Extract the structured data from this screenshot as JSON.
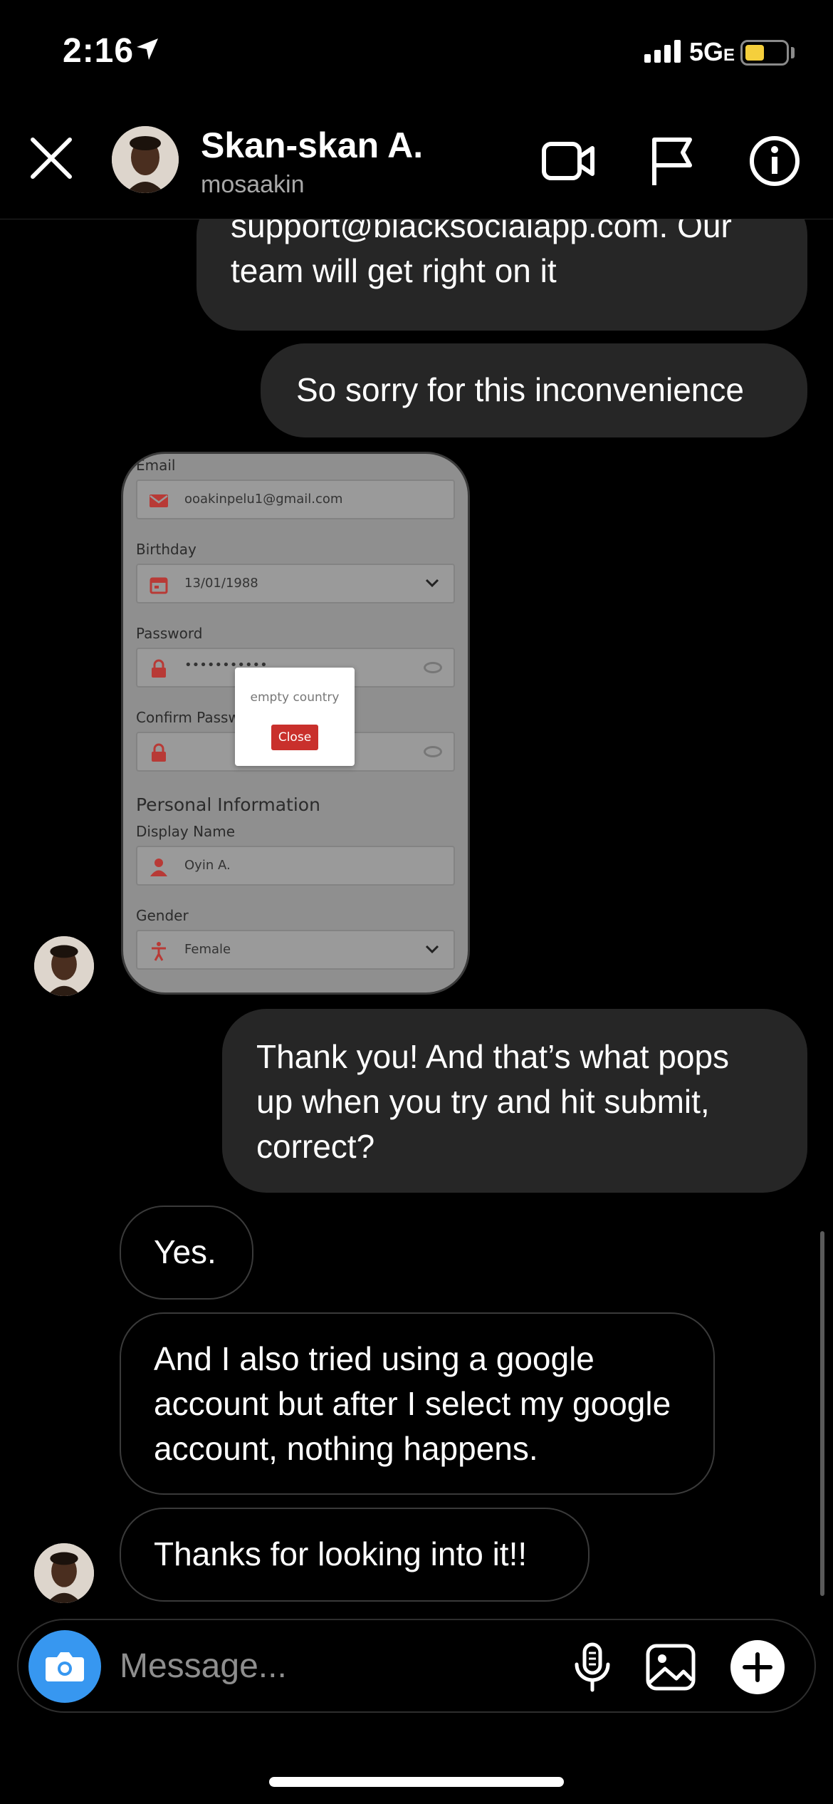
{
  "status_bar": {
    "time": "2:16",
    "network": "5G",
    "network_suffix": "E",
    "battery_color": "#f5cf3c"
  },
  "header": {
    "name": "Skan-skan A.",
    "handle": "mosaakin",
    "icons": [
      "close-icon",
      "video-call-icon",
      "flag-icon",
      "info-icon"
    ]
  },
  "messages": [
    {
      "from": "me",
      "text": "support@blacksocialapp.com. Our team will get right on it"
    },
    {
      "from": "me",
      "text": "So sorry for this inconvenience"
    },
    {
      "from": "them",
      "type": "image"
    },
    {
      "from": "me",
      "text": "Thank you! And that’s what pops up when you try and hit submit, correct?"
    },
    {
      "from": "them",
      "text": "Yes."
    },
    {
      "from": "them",
      "text": "And I also tried using a google account but after I select my google account, nothing happens."
    },
    {
      "from": "them",
      "text": "Thanks for looking into it!!"
    }
  ],
  "screenshot": {
    "email_label": "Email",
    "email_value": "ooakinpelu1@gmail.com",
    "birthday_label": "Birthday",
    "birthday_value": "13/01/1988",
    "password_label": "Password",
    "password_value": "•••••••••••",
    "confirm_label": "Confirm Passwo",
    "section_title": "Personal Information",
    "display_name_label": "Display Name",
    "display_name_value": "Oyin A.",
    "gender_label": "Gender",
    "gender_value": "Female",
    "dialog_text": "empty country",
    "dialog_button": "Close",
    "accent": "#c9302c"
  },
  "composer": {
    "placeholder": "Message...",
    "accent": "#3797f0",
    "icons": [
      "camera-icon",
      "microphone-icon",
      "gallery-icon",
      "plus-icon"
    ]
  }
}
